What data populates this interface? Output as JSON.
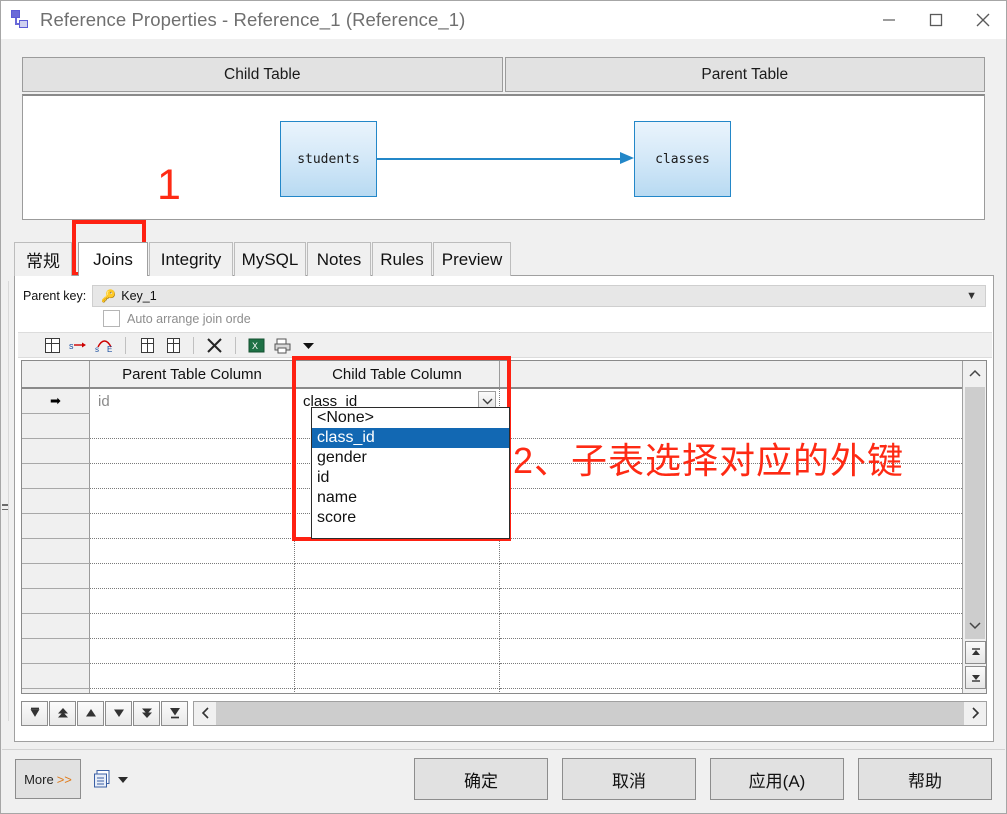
{
  "window": {
    "title": "Reference Properties - Reference_1 (Reference_1)",
    "icon": "reference-icon",
    "controls": {
      "minimize": "minimize-icon",
      "maximize": "maximize-icon",
      "close": "close-icon"
    }
  },
  "diagram": {
    "child_header": "Child Table",
    "parent_header": "Parent Table",
    "child_table": "students",
    "parent_table": "classes",
    "relation": "one-to-many-arrow"
  },
  "annotations": {
    "step1": "1",
    "step2": "2、子表选择对应的外键",
    "color": "#fe2a14"
  },
  "tabs": [
    {
      "label": "常规",
      "active": false
    },
    {
      "label": "Joins",
      "active": true
    },
    {
      "label": "Integrity",
      "active": false
    },
    {
      "label": "MySQL",
      "active": false
    },
    {
      "label": "Notes",
      "active": false
    },
    {
      "label": "Rules",
      "active": false
    },
    {
      "label": "Preview",
      "active": false
    }
  ],
  "joins_panel": {
    "parent_key_label": "Parent key:",
    "parent_key_value": "Key_1",
    "parent_key_icon": "key-icon",
    "auto_arrange_label": "Auto arrange join orde",
    "auto_arrange_checked": false,
    "toolbar": [
      {
        "name": "select-columns-icon",
        "title": ""
      },
      {
        "name": "map-columns-icon",
        "title": ""
      },
      {
        "name": "auto-map-columns-icon",
        "title": ""
      },
      {
        "name": "insert-row-icon",
        "title": ""
      },
      {
        "name": "append-row-icon",
        "title": ""
      },
      {
        "name": "delete-row-icon",
        "title": ""
      },
      {
        "name": "export-excel-icon",
        "title": ""
      },
      {
        "name": "print-icon",
        "title": ""
      },
      {
        "name": "dropdown-arrow-icon",
        "title": ""
      }
    ],
    "grid": {
      "headers": [
        "",
        "Parent Table Column",
        "Child Table Column",
        ""
      ],
      "rows": [
        {
          "marker": "➡",
          "parent_column": "id",
          "child_column": "class_id"
        },
        {
          "marker": "",
          "parent_column": "",
          "child_column": ""
        },
        {
          "marker": "",
          "parent_column": "",
          "child_column": ""
        },
        {
          "marker": "",
          "parent_column": "",
          "child_column": ""
        },
        {
          "marker": "",
          "parent_column": "",
          "child_column": ""
        },
        {
          "marker": "",
          "parent_column": "",
          "child_column": ""
        },
        {
          "marker": "",
          "parent_column": "",
          "child_column": ""
        },
        {
          "marker": "",
          "parent_column": "",
          "child_column": ""
        },
        {
          "marker": "",
          "parent_column": "",
          "child_column": ""
        },
        {
          "marker": "",
          "parent_column": "",
          "child_column": ""
        },
        {
          "marker": "",
          "parent_column": "",
          "child_column": ""
        },
        {
          "marker": "",
          "parent_column": "",
          "child_column": ""
        },
        {
          "marker": "",
          "parent_column": "",
          "child_column": ""
        }
      ]
    },
    "dropdown": {
      "open": true,
      "selected": "class_id",
      "options": [
        "<None>",
        "class_id",
        "gender",
        "id",
        "name",
        "score"
      ],
      "highlight_color": "#1268b3"
    },
    "nav_buttons": [
      {
        "name": "go-first-record",
        "glyph": "⤒"
      },
      {
        "name": "go-prev-page",
        "glyph": "⇧"
      },
      {
        "name": "go-prev-record",
        "glyph": "▲"
      },
      {
        "name": "go-next-record",
        "glyph": "▼"
      },
      {
        "name": "go-next-page",
        "glyph": "⇩"
      },
      {
        "name": "go-last-record",
        "glyph": "⤓"
      }
    ]
  },
  "footer": {
    "more_label": "More",
    "more_chevron": ">>",
    "script_icon": "script-icon",
    "buttons": [
      {
        "name": "ok-button",
        "label": "确定"
      },
      {
        "name": "cancel-button",
        "label": "取消"
      },
      {
        "name": "apply-button",
        "label": "应用(A)"
      },
      {
        "name": "help-button",
        "label": "帮助"
      }
    ]
  }
}
